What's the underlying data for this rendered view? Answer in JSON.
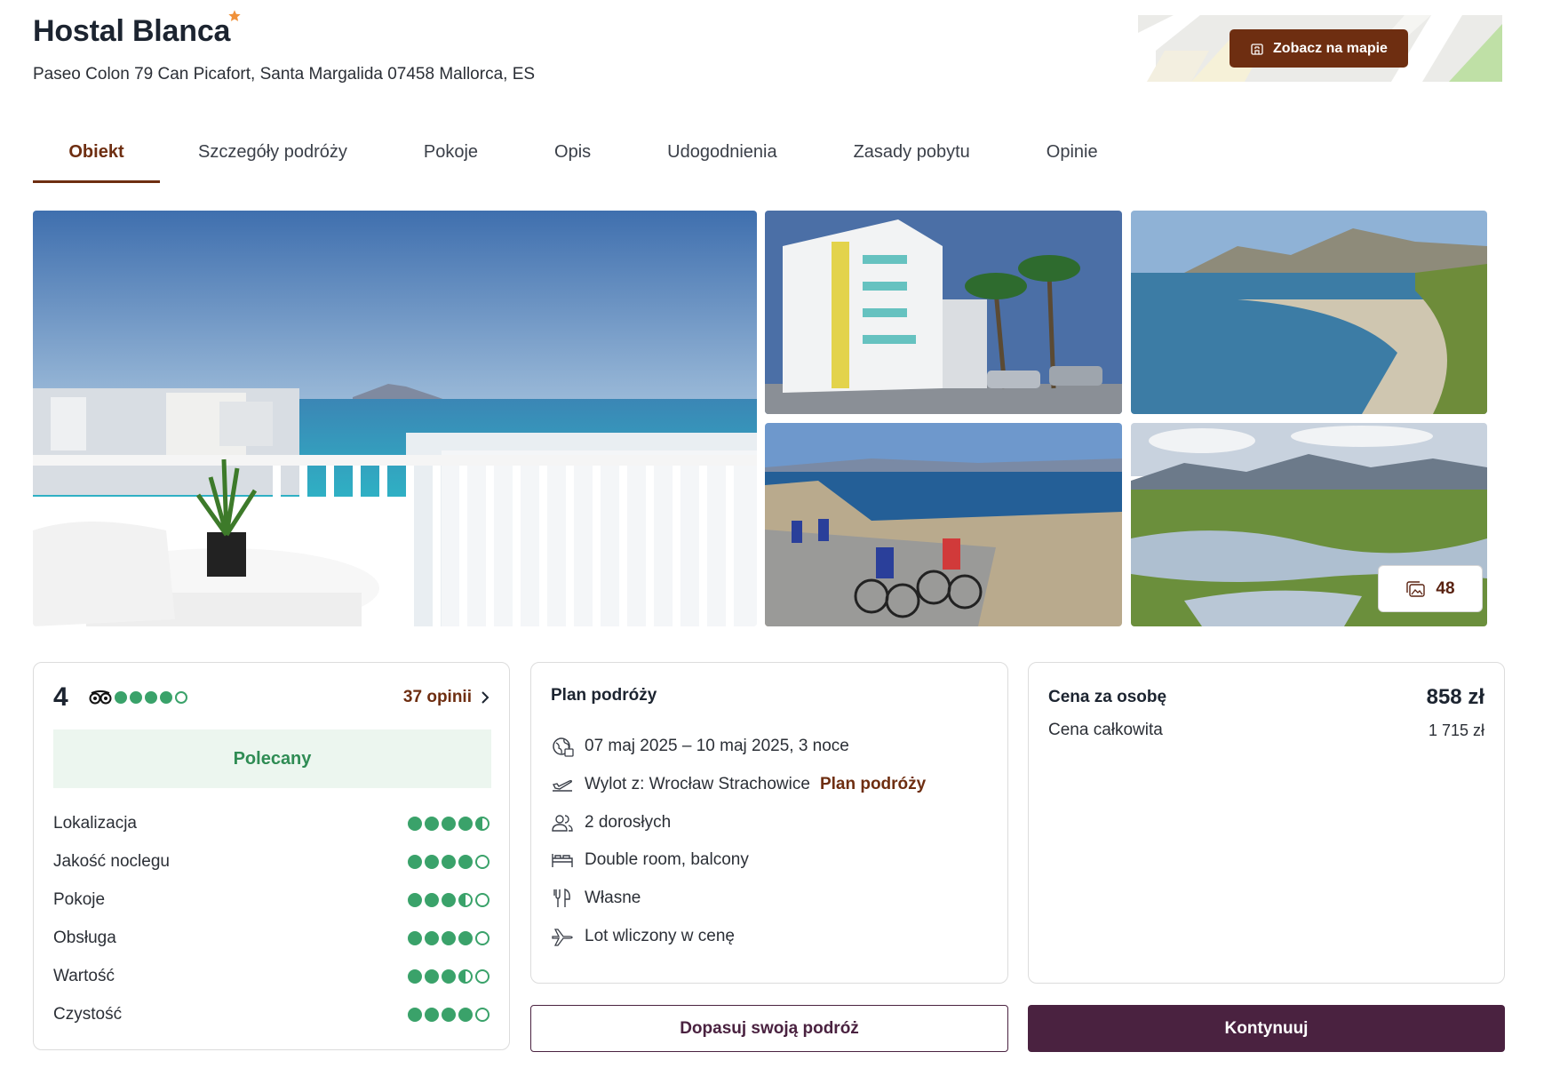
{
  "header": {
    "hotel_name": "Hostal Blanca",
    "stars": 1,
    "address": "Paseo Colon 79 Can Picafort, Santa Margalida 07458 Mallorca, ES",
    "map_button_label": "Zobacz na mapie"
  },
  "tabs": [
    {
      "label": "Obiekt",
      "active": true
    },
    {
      "label": "Szczegóły podróży",
      "active": false
    },
    {
      "label": "Pokoje",
      "active": false
    },
    {
      "label": "Opis",
      "active": false
    },
    {
      "label": "Udogodnienia",
      "active": false
    },
    {
      "label": "Zasady pobytu",
      "active": false
    },
    {
      "label": "Opinie",
      "active": false
    }
  ],
  "gallery": {
    "photo_count": "48",
    "photos": [
      "balcony-sea-view",
      "hotel-building",
      "beach-bay",
      "cyclists-coast",
      "wetland-mountains"
    ]
  },
  "reviews": {
    "rating": "4",
    "rating_dots": 4,
    "reviews_link": "37 opinii",
    "recommended_label": "Polecany",
    "subratings": [
      {
        "label": "Lokalizacja",
        "score": 4.5
      },
      {
        "label": "Jakość noclegu",
        "score": 4
      },
      {
        "label": "Pokoje",
        "score": 3.5
      },
      {
        "label": "Obsługa",
        "score": 4
      },
      {
        "label": "Wartość",
        "score": 3.5
      },
      {
        "label": "Czystość",
        "score": 4
      }
    ]
  },
  "plan": {
    "heading": "Plan podróży",
    "dates": "07 maj 2025 – 10 maj 2025, 3 noce",
    "departure": "Wylot z: Wrocław Strachowice",
    "departure_link": "Plan podróży",
    "guests": "2 dorosłych",
    "room": "Double room, balcony",
    "board": "Własne",
    "flight": "Lot wliczony w cenę"
  },
  "price": {
    "per_person_label": "Cena za osobę",
    "per_person_value": "858 zł",
    "total_label": "Cena całkowita",
    "total_value": "1 715 zł"
  },
  "actions": {
    "customize_label": "Dopasuj swoją podróż",
    "continue_label": "Kontynuuj"
  },
  "colors": {
    "brand_brown": "#6e2e11",
    "brand_plum": "#4a2240",
    "rating_green": "#3aa26a",
    "star_orange": "#f0913a"
  }
}
